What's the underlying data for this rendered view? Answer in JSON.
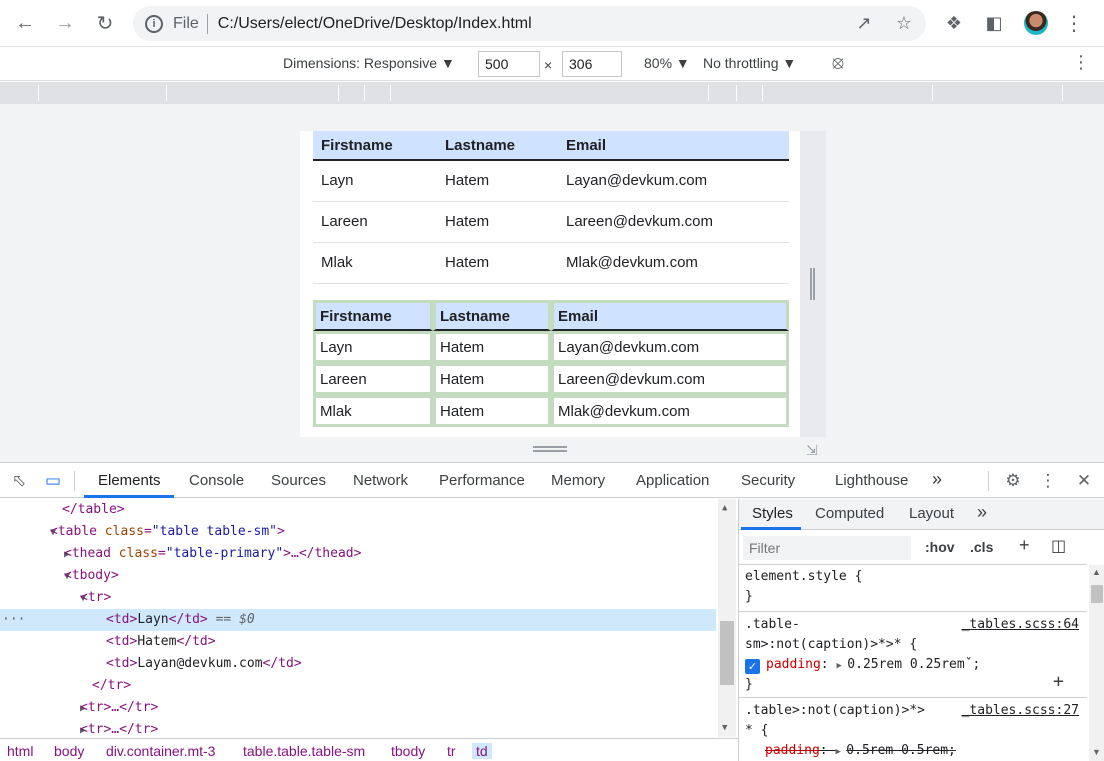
{
  "browser": {
    "url_scheme_label": "File",
    "url": "C:/Users/elect/OneDrive/Desktop/Index.html",
    "icons": [
      "back-arrow-icon",
      "forward-arrow-icon",
      "reload-icon",
      "share-icon",
      "star-icon",
      "puzzle-icon",
      "side-panel-icon",
      "avatar",
      "kebab-menu-icon"
    ]
  },
  "device_toolbar": {
    "dimensions_label": "Dimensions: Responsive ▼",
    "width_value": "500",
    "times": "×",
    "height_value": "306",
    "zoom_label": "80% ▼",
    "throttle_label": "No throttling ▼"
  },
  "page": {
    "table1": {
      "headers": [
        "Firstname",
        "Lastname",
        "Email"
      ],
      "rows": [
        [
          "Layn",
          "Hatem",
          "Layan@devkum.com"
        ],
        [
          "Lareen",
          "Hatem",
          "Lareen@devkum.com"
        ],
        [
          "Mlak",
          "Hatem",
          "Mlak@devkum.com"
        ]
      ]
    },
    "table2": {
      "headers": [
        "Firstname",
        "Lastname",
        "Email"
      ],
      "rows": [
        [
          "Layn",
          "Hatem",
          "Layan@devkum.com"
        ],
        [
          "Lareen",
          "Hatem",
          "Lareen@devkum.com"
        ],
        [
          "Mlak",
          "Hatem",
          "Mlak@devkum.com"
        ]
      ]
    }
  },
  "devtools": {
    "tabs": [
      "Elements",
      "Console",
      "Sources",
      "Network",
      "Performance",
      "Memory",
      "Application",
      "Security",
      "Lighthouse"
    ],
    "more_tabs": "»",
    "elements": {
      "l0": "</table>",
      "l1_tag_open": "<table ",
      "l1_attr": "class",
      "l1_val": "\"table table-sm\"",
      "l1_close": ">",
      "l2_tag_open": "<thead ",
      "l2_attr": "class",
      "l2_val": "\"table-primary\"",
      "l2_close": ">…</thead>",
      "l3": "<tbody>",
      "l4": "<tr>",
      "l5_open": "<td>",
      "l5_text": "Layn",
      "l5_close": "</td>",
      "l5_marker": "== $0",
      "l6_open": "<td>",
      "l6_text": "Hatem",
      "l6_close": "</td>",
      "l7_open": "<td>",
      "l7_text": "Layan@devkum.com",
      "l7_close": "</td>",
      "l8": "</tr>",
      "l9": "<tr>…</tr>",
      "l10": "<tr>…</tr>",
      "ellipsis": "···"
    },
    "breadcrumbs": [
      "html",
      "body",
      "div.container.mt-3",
      "table.table.table-sm",
      "tbody",
      "tr",
      "td"
    ],
    "styles": {
      "tabs": [
        "Styles",
        "Computed",
        "Layout"
      ],
      "more": "»",
      "filter_placeholder": "Filter",
      "hov": ":hov",
      "cls": ".cls",
      "plus": "+",
      "r1_selector": "element.style {",
      "r1_close": "}",
      "r2_selector_a": ".table-",
      "r2_selector_b": "sm>:not(caption)>*>* {",
      "r2_source": "_tables.scss:64",
      "r2_prop": "padding",
      "r2_val": "0.25rem 0.25rem",
      "r2_close": "}",
      "r3_selector_a": ".table>:not(caption)>*>",
      "r3_selector_b": "* {",
      "r3_source": "_tables.scss:27",
      "r3_prop": "padding",
      "r3_val": "0.5rem 0.5rem"
    }
  },
  "colors": {
    "accent": "#1a73e8",
    "table_header": "#cfe2ff",
    "table_border_green": "#c3dbbf",
    "selected_row": "#cfe8fc"
  }
}
